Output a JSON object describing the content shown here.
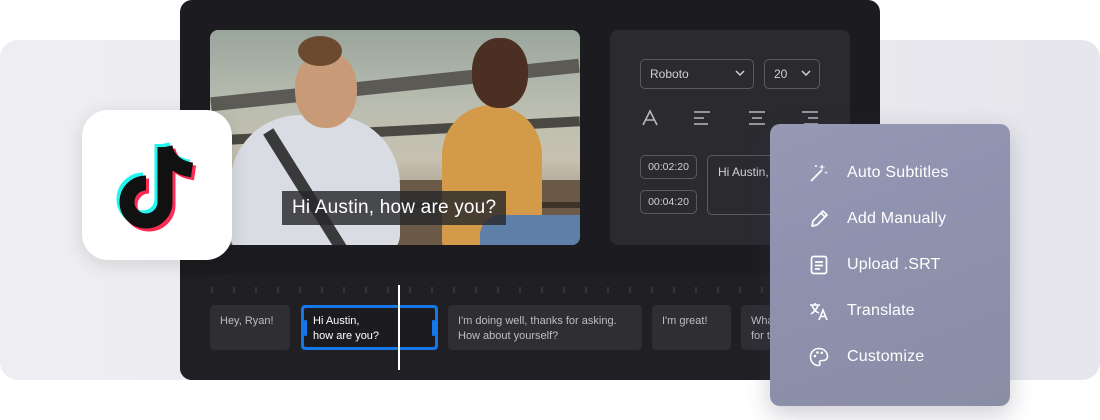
{
  "video": {
    "caption": "Hi Austin, how are you?"
  },
  "properties": {
    "font": "Roboto",
    "size": "20",
    "timestamps": [
      "00:02:20",
      "00:04:20"
    ],
    "caption_edit": "Hi Austin, how are you?"
  },
  "timeline": {
    "clips": [
      {
        "line1": "Hey, Ryan!",
        "line2": ""
      },
      {
        "line1": "Hi Austin,",
        "line2": "how are you?"
      },
      {
        "line1": "I'm doing well, thanks for asking.",
        "line2": "How about yourself?"
      },
      {
        "line1": "I'm great!",
        "line2": ""
      },
      {
        "line1": "Wha",
        "line2": "for t"
      }
    ]
  },
  "menu": {
    "items": [
      {
        "label": "Auto Subtitles",
        "icon": "magic-wand-icon"
      },
      {
        "label": "Add Manually",
        "icon": "pencil-icon"
      },
      {
        "label": "Upload .SRT",
        "icon": "document-icon"
      },
      {
        "label": "Translate",
        "icon": "translate-icon"
      },
      {
        "label": "Customize",
        "icon": "palette-icon"
      }
    ]
  },
  "colors": {
    "accent": "#1577e8",
    "editor_bg": "#1c1c20",
    "menu_bg": "#9698b4",
    "tiktok_cyan": "#25f4ee",
    "tiktok_red": "#fe2c55"
  }
}
